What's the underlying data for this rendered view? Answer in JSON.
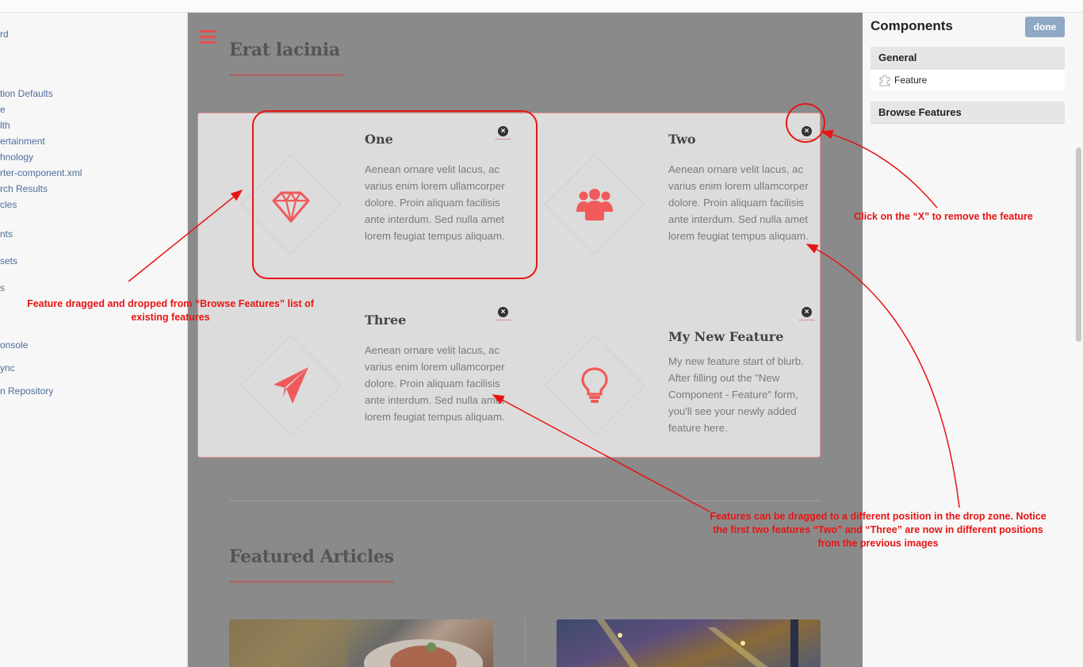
{
  "left_nav": {
    "items": [
      "rd",
      "tion Defaults",
      "e",
      "lth",
      "ertainment",
      "hnology",
      "rter-component.xml",
      "rch Results",
      "cles",
      "nts",
      "sets",
      "s",
      "onsole",
      "ync",
      "n Repository"
    ]
  },
  "page": {
    "section_title": "Erat lacinia",
    "features": [
      {
        "title": "One",
        "body": "Aenean ornare velit lacus, ac varius enim lorem ullamcorper dolore. Proin aliquam facilisis ante interdum. Sed nulla amet lorem feugiat tempus aliquam.",
        "icon": "diamond-gem-icon",
        "close": "×"
      },
      {
        "title": "Two",
        "body": "Aenean ornare velit lacus, ac varius enim lorem ullamcorper dolore. Proin aliquam facilisis ante interdum. Sed nulla amet lorem feugiat tempus aliquam.",
        "icon": "users-group-icon",
        "close": "×"
      },
      {
        "title": "Three",
        "body": "Aenean ornare velit lacus, ac varius enim lorem ullamcorper dolore. Proin aliquam facilisis ante interdum. Sed nulla amet lorem feugiat tempus aliquam.",
        "icon": "paper-plane-icon",
        "close": "×"
      },
      {
        "title": "My New Feature",
        "body": "My new feature start of blurb.  After filling out the \"New Component - Feature\" form, you'll see your newly added feature here.",
        "icon": "lightbulb-icon",
        "close": "×"
      }
    ],
    "articles_title": "Featured Articles"
  },
  "components_panel": {
    "title": "Components",
    "done_label": "done",
    "groups": [
      {
        "label": "General",
        "items": [
          "Feature"
        ]
      },
      {
        "label": "Browse Features",
        "items": []
      }
    ]
  },
  "annotations": {
    "drag_drop": "Feature dragged and dropped from “Browse Features” list of existing features",
    "remove": "Click on the “X” to remove the feature",
    "reorder": "Features can be dragged to a different position in the drop zone. Notice the first two features “Two” and “Three” are now in different positions from the previous images"
  },
  "colors": {
    "accent": "#f05a5a",
    "annotation": "#e81414",
    "canvas_overlay": "#8a8a8a",
    "done_button": "#8fa8c4"
  }
}
